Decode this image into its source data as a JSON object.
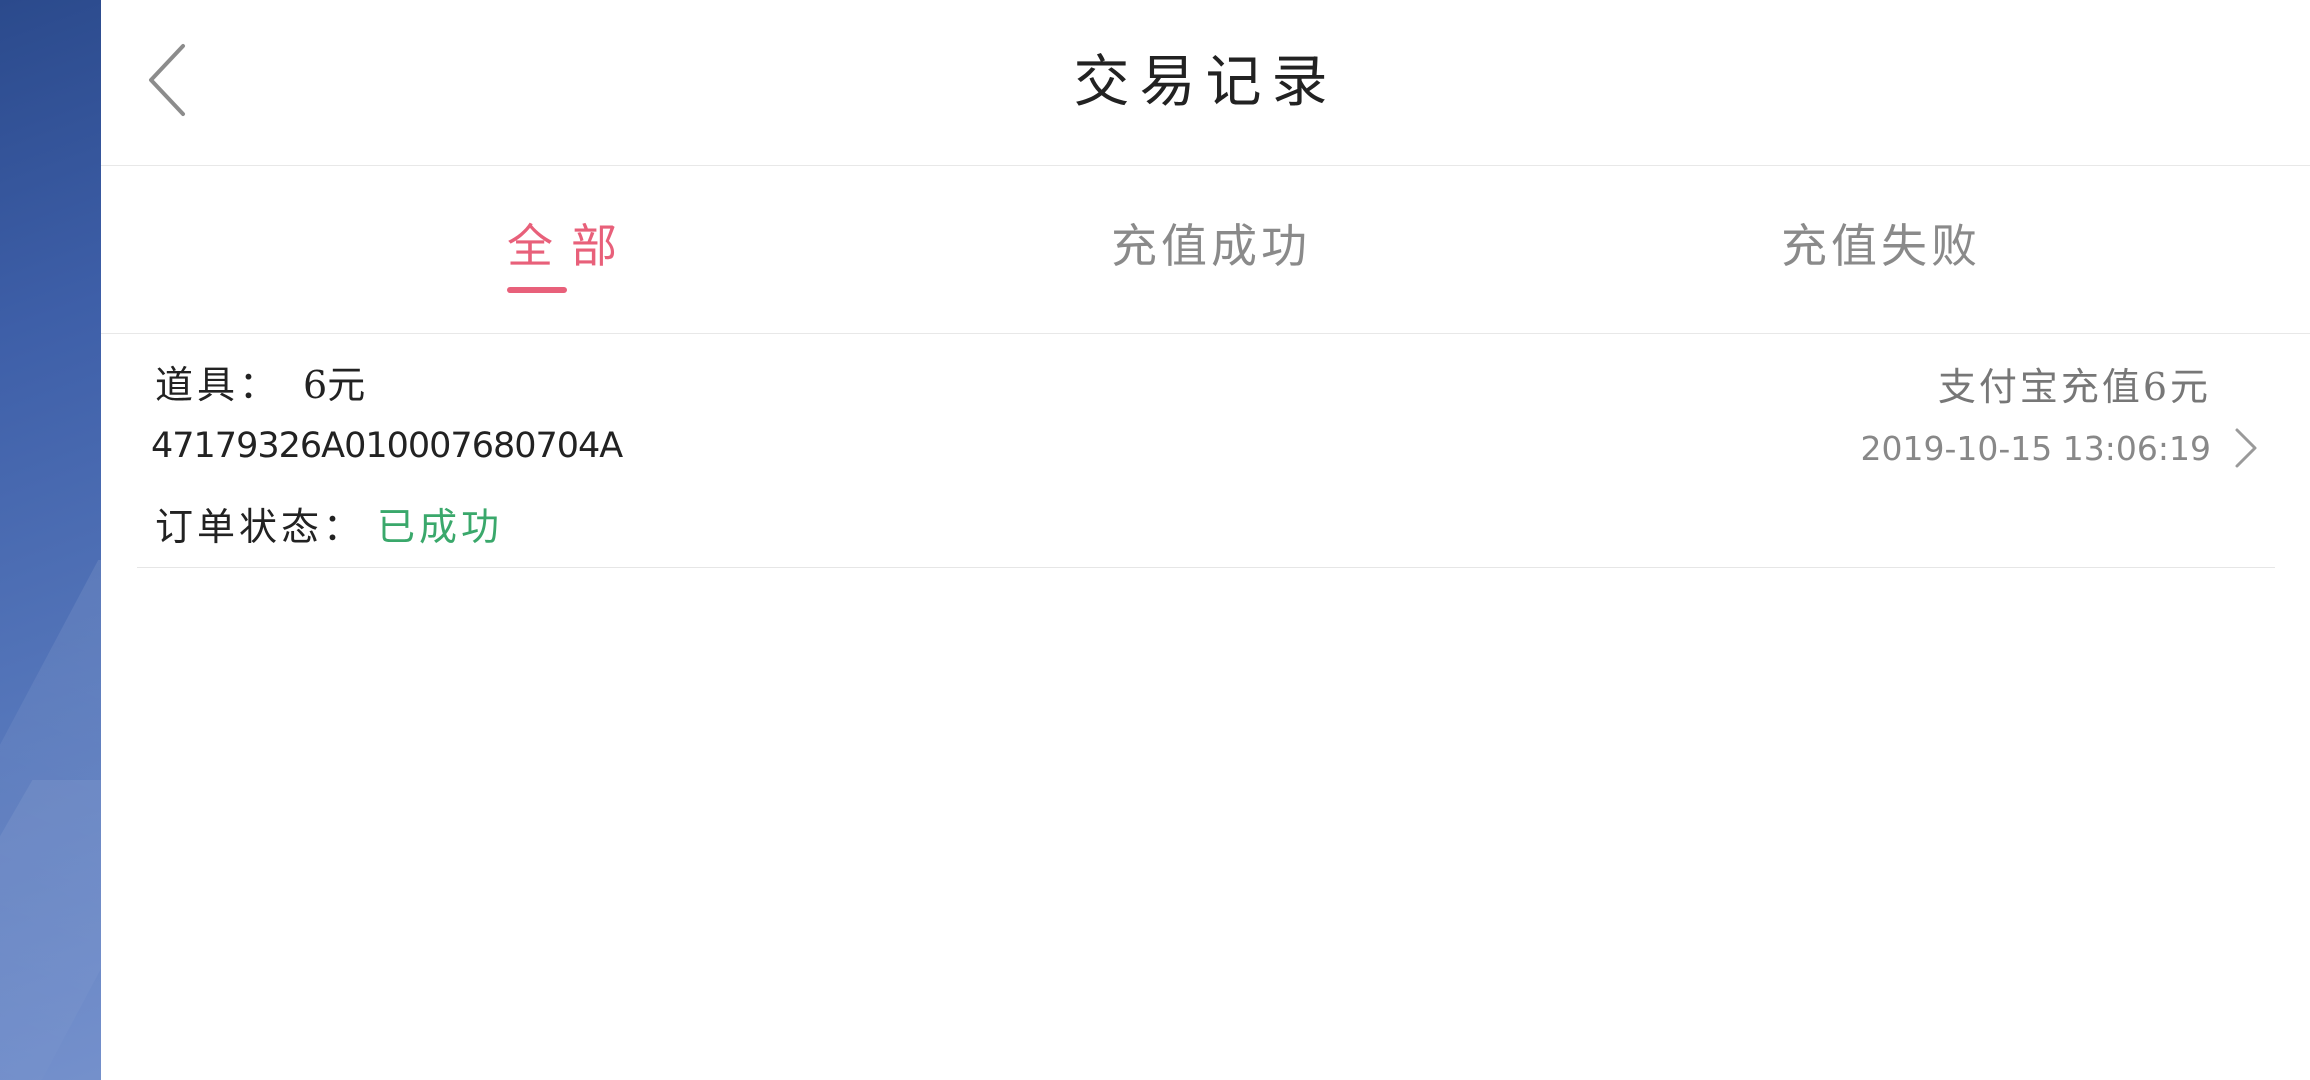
{
  "header": {
    "title": "交易记录",
    "back_icon": "chevron-left-icon"
  },
  "tabs": [
    {
      "label": "全部",
      "active": true
    },
    {
      "label": "充值成功",
      "active": false
    },
    {
      "label": "充值失败",
      "active": false
    }
  ],
  "records": [
    {
      "item_label": "道具：",
      "item_value": "6元",
      "order_no": "47179326A010007680704A",
      "status_label": "订单状态：",
      "status_value": "已成功",
      "description": "支付宝充值6元",
      "time": "2019-10-15  13:06:19"
    }
  ],
  "colors": {
    "accent": "#e8607a",
    "success": "#3aa86b",
    "sidebar": "#3e5fa8"
  }
}
